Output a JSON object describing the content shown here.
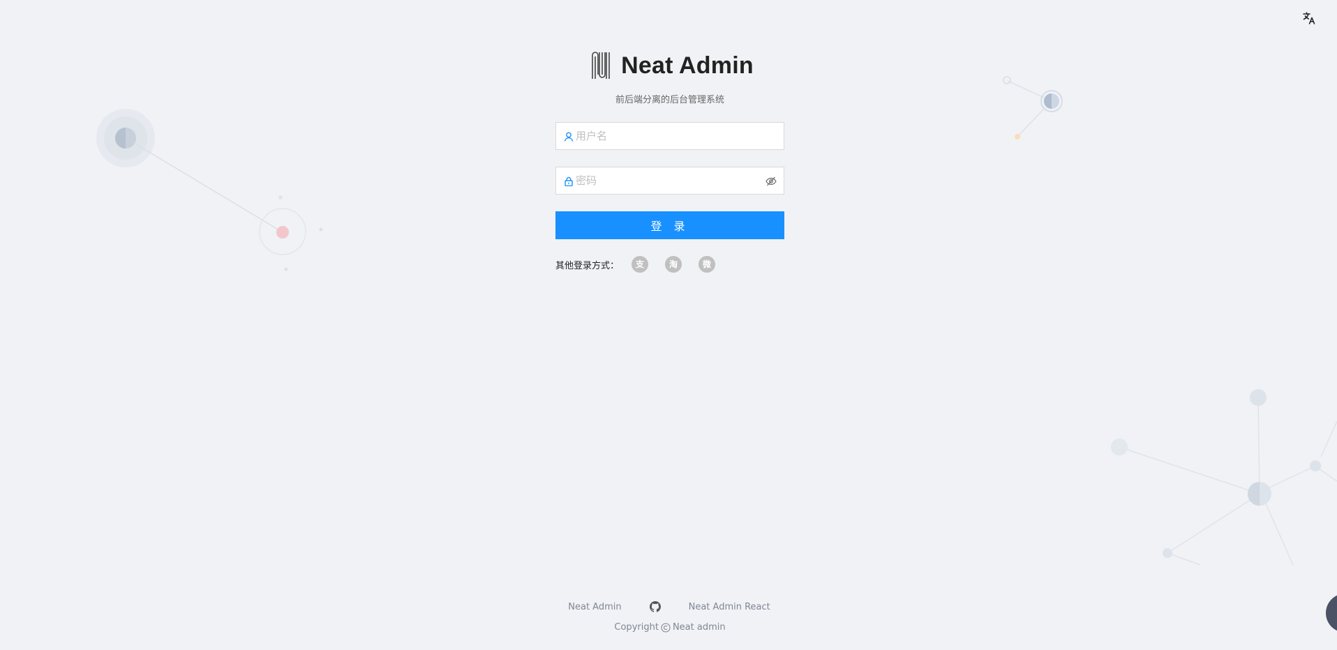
{
  "brand": {
    "title": "Neat Admin",
    "subtitle": "前后端分离的后台管理系统"
  },
  "form": {
    "username_placeholder": "用户名",
    "password_placeholder": "密码",
    "login_label": "登 录"
  },
  "other_login": {
    "label": "其他登录方式：",
    "providers": [
      {
        "name": "alipay",
        "glyph": "支"
      },
      {
        "name": "taobao",
        "glyph": "淘"
      },
      {
        "name": "weibo",
        "glyph": "微"
      }
    ]
  },
  "footer": {
    "link_1": "Neat Admin",
    "link_2": "Neat Admin React",
    "copyright_prefix": "Copyright",
    "copyright_owner": "Neat admin"
  },
  "colors": {
    "primary": "#1890ff",
    "background": "#f0f2f5"
  },
  "icons": [
    "translate-icon",
    "user-icon",
    "lock-icon",
    "eye-invisible-icon",
    "github-icon",
    "copyright-icon"
  ]
}
